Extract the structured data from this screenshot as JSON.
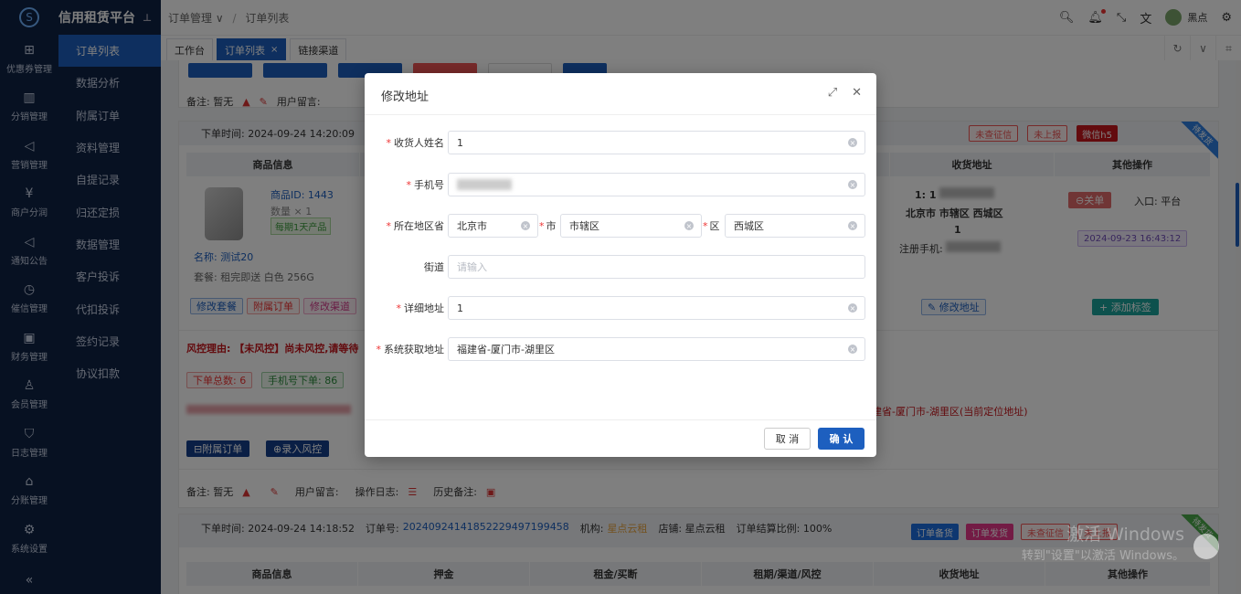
{
  "app": {
    "title": "信用租赁平台"
  },
  "iconbar": {
    "items": [
      {
        "label": "优惠券管理",
        "icon": "gift-icon"
      },
      {
        "label": "分销管理",
        "icon": "chart-icon"
      },
      {
        "label": "营销管理",
        "icon": "megaphone-icon"
      },
      {
        "label": "商户分润",
        "icon": "coin-icon"
      },
      {
        "label": "通知公告",
        "icon": "bell-icon"
      },
      {
        "label": "催信管理",
        "icon": "clock-icon"
      },
      {
        "label": "财务管理",
        "icon": "finance-icon"
      },
      {
        "label": "会员管理",
        "icon": "user-icon"
      },
      {
        "label": "日志管理",
        "icon": "shield-icon"
      },
      {
        "label": "分账管理",
        "icon": "home-icon"
      },
      {
        "label": "系统设置",
        "icon": "gear-icon"
      }
    ]
  },
  "menu": {
    "items": [
      "订单列表",
      "数据分析",
      "附属订单",
      "资料管理",
      "自提记录",
      "归还定损",
      "数据管理",
      "客户投诉",
      "代扣投诉",
      "签约记录",
      "协议扣款"
    ]
  },
  "header": {
    "breadcrumb": [
      "订单管理",
      "订单列表"
    ],
    "username": "黑点"
  },
  "tabs": [
    "工作台",
    "订单列表",
    "链接渠道"
  ],
  "card1": {
    "notes_label": "备注: 暂无",
    "user_msg": "用户留言:"
  },
  "order1": {
    "time": "下单时间: 2024-09-24 14:20:09",
    "tags": [
      "未查征信",
      "未上报",
      "微信h5"
    ],
    "ribbon": "待发货",
    "columns": [
      "商品信息",
      "收货地址",
      "其他操作"
    ],
    "product_id": "商品ID: 1443",
    "quantity": "数量 × 1",
    "badge": "每期1天产品",
    "name": "名称: 测试20",
    "package": "套餐: 租完即送 白色 256G",
    "actions": [
      "修改套餐",
      "附属订单",
      "修改渠道"
    ],
    "address_line1": "1:  1",
    "address_line2": "北京市 市辖区 西城区",
    "address_line3": "1",
    "reg_phone": "注册手机:",
    "close_btn": "⊖关单",
    "entry": "入口: 平台",
    "date_chip": "2024-09-23 16:43:12",
    "edit_address": "修改地址",
    "add_tag": "+ 添加标签",
    "risk": "风控理由: 【未风控】尚未风控,请等待",
    "counts": [
      "下单总数: 6",
      "手机号下单: 86"
    ],
    "location": "建省-厦门市-湖里区(当前定位地址)",
    "btns": [
      "附属订单",
      "录入风控"
    ],
    "notes": "备注: 暂无",
    "user_msg": "用户留言:",
    "op_log": "操作日志:",
    "history": "历史备注:"
  },
  "order2": {
    "time": "下单时间: 2024-09-24 14:18:52",
    "order_no_label": "订单号:",
    "order_no": "20240924141852229497199458",
    "org_label": "机构:",
    "org": "星点云租",
    "shop": "店铺: 星点云租",
    "ratio": "订单结算比例: 100%",
    "tags": [
      "订单备货",
      "订单发货",
      "未查征信",
      "未上报"
    ],
    "ribbon": "待发货",
    "columns": [
      "商品信息",
      "押金",
      "租金/买断",
      "租期/渠道/风控",
      "收货地址",
      "其他操作"
    ]
  },
  "modal": {
    "title": "修改地址",
    "fields": {
      "name_label": "收货人姓名",
      "name_value": "1",
      "phone_label": "手机号",
      "region_label": "所在地区省",
      "province": "北京市",
      "city_label": "市",
      "city": "市辖区",
      "district_label": "区",
      "district": "西城区",
      "street_label": "街道",
      "street_placeholder": "请输入",
      "detail_label": "详细地址",
      "detail_value": "1",
      "system_label": "系统获取地址",
      "system_value": "福建省-厦门市-湖里区"
    },
    "cancel": "取 消",
    "confirm": "确 认"
  },
  "watermark": {
    "line1": "激活 Windows",
    "line2": "转到\"设置\"以激活 Windows。"
  }
}
